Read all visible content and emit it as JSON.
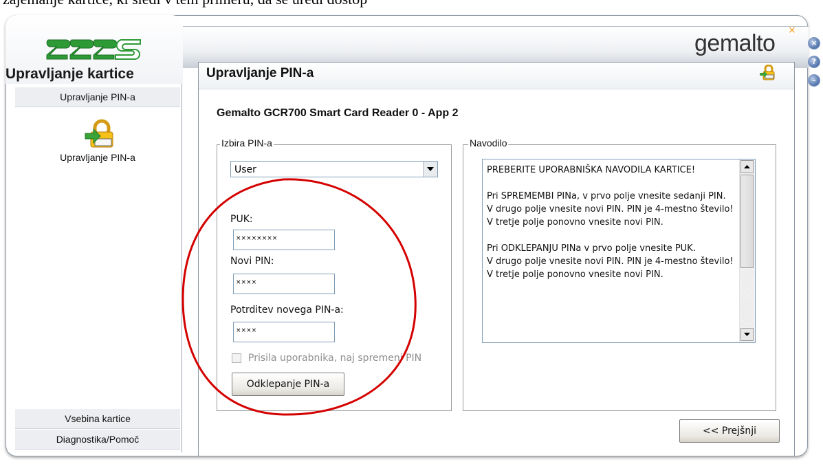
{
  "top_caption": "zajemanje kartice, ki sledi v tem primeru, da se uredi dostop",
  "app": {
    "title": "Upravljanje kartice",
    "brand": "gemalto",
    "brand_mark": "×"
  },
  "window_buttons": [
    {
      "name": "close-button",
      "glyph": "×"
    },
    {
      "name": "help-button",
      "glyph": "?"
    },
    {
      "name": "minimize-button",
      "glyph": "–"
    }
  ],
  "sidebar": {
    "top_item": "Upravljanje PIN-a",
    "icon_label": "Upravljanje PIN-a",
    "bottom_items": [
      "Vsebina kartice",
      "Diagnostika/Pomoč"
    ]
  },
  "panel": {
    "title": "Upravljanje PIN-a",
    "reader": "Gemalto GCR700 Smart Card Reader 0 - App 2"
  },
  "pin_group": {
    "legend": "Izbira PIN-a",
    "selected": "User",
    "puk_label": "PUK:",
    "puk_value": "××××××××",
    "new_pin_label": "Novi PIN:",
    "new_pin_value": "××××",
    "confirm_label": "Potrditev novega PIN-a:",
    "confirm_value": "××××",
    "force_change_label": "Prisila uporabnika, naj spremeni PIN",
    "force_change_checked": false,
    "unlock_button": "Odklepanje PIN-a"
  },
  "help_group": {
    "legend": "Navodilo",
    "text": "PREBERITE UPORABNIŠKA NAVODILA KARTICE!\n\nPri SPREMEMBI PINa, v prvo polje vnesite sedanji PIN.\nV drugo polje vnesite novi PIN. PIN je 4-mestno število!\nV tretje polje ponovno vnesite novi PIN.\n\nPri ODKLEPANJU PINa v prvo polje vnesite PUK.\nV drugo polje vnesite novi PIN. PIN je 4-mestno število!\nV tretje polje ponovno vnesite novi PIN."
  },
  "back_button": "<< Prejšnji",
  "colors": {
    "annotation_circle": "#d40000",
    "window_button": "#5e7fb5",
    "brand_accent": "#f39a1d"
  }
}
